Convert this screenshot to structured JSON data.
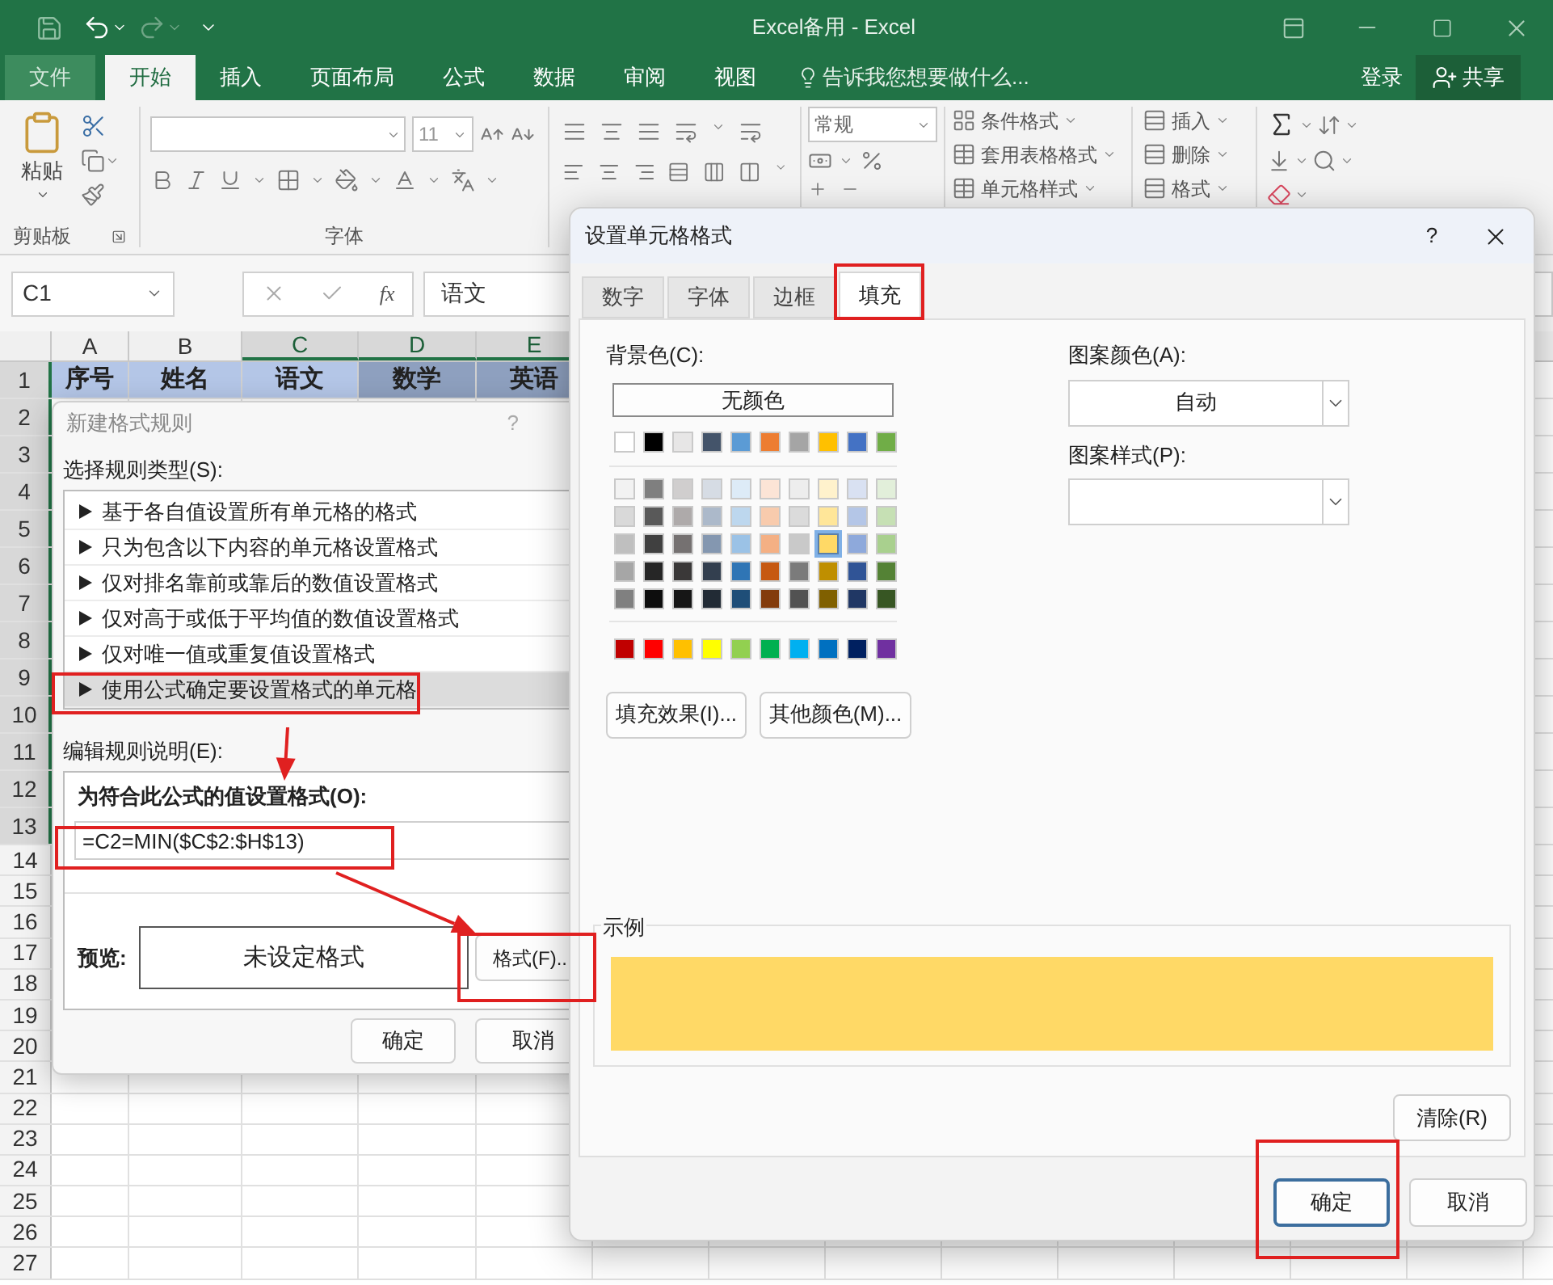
{
  "window": {
    "title": "Excel备用 - Excel"
  },
  "ribbon_tabs": [
    {
      "label": "文件",
      "kind": "file",
      "selected": false
    },
    {
      "label": "开始",
      "kind": "tab",
      "selected": true
    },
    {
      "label": "插入",
      "kind": "tab",
      "selected": false
    },
    {
      "label": "页面布局",
      "kind": "tab",
      "selected": false
    },
    {
      "label": "公式",
      "kind": "tab",
      "selected": false
    },
    {
      "label": "数据",
      "kind": "tab",
      "selected": false
    },
    {
      "label": "审阅",
      "kind": "tab",
      "selected": false
    },
    {
      "label": "视图",
      "kind": "tab",
      "selected": false
    }
  ],
  "tell_me": {
    "placeholder": "告诉我您想要做什么..."
  },
  "sign_in": "登录",
  "share": "共享",
  "ribbon": {
    "paste": "粘贴",
    "clipboard_label": "剪贴板",
    "font_size": "11",
    "font_label": "字体",
    "number_format": "常规",
    "styles": [
      "条件格式",
      "套用表格格式",
      "单元格样式"
    ],
    "cells": [
      "插入",
      "删除",
      "格式"
    ]
  },
  "formula_bar": {
    "name_box": "C1",
    "function_label": "fx",
    "value": "语文"
  },
  "sheet": {
    "columns": [
      {
        "label": "A",
        "selected": false
      },
      {
        "label": "B",
        "selected": false
      },
      {
        "label": "C",
        "selected": true
      },
      {
        "label": "D",
        "selected": true
      },
      {
        "label": "E",
        "selected": true
      }
    ],
    "header_cells": [
      {
        "text": "序号",
        "selected": false
      },
      {
        "text": "姓名",
        "selected": false
      },
      {
        "text": "语文",
        "selected": false
      },
      {
        "text": "数学",
        "selected": true
      },
      {
        "text": "英语",
        "selected": true
      }
    ],
    "rows": [
      {
        "label": "1",
        "selected": true
      },
      {
        "label": "2",
        "selected": true
      },
      {
        "label": "3",
        "selected": true
      },
      {
        "label": "4",
        "selected": true
      },
      {
        "label": "5",
        "selected": true
      },
      {
        "label": "6",
        "selected": true
      },
      {
        "label": "7",
        "selected": true
      },
      {
        "label": "8",
        "selected": true
      },
      {
        "label": "9",
        "selected": true
      },
      {
        "label": "10",
        "selected": true
      },
      {
        "label": "11",
        "selected": true
      },
      {
        "label": "12",
        "selected": true
      },
      {
        "label": "13",
        "selected": true
      },
      {
        "label": "14",
        "selected": false
      },
      {
        "label": "15",
        "selected": false
      },
      {
        "label": "16",
        "selected": false
      },
      {
        "label": "17",
        "selected": false
      },
      {
        "label": "18",
        "selected": false
      },
      {
        "label": "19",
        "selected": false
      },
      {
        "label": "20",
        "selected": false
      },
      {
        "label": "21",
        "selected": false
      },
      {
        "label": "22",
        "selected": false
      },
      {
        "label": "23",
        "selected": false
      },
      {
        "label": "24",
        "selected": false
      },
      {
        "label": "25",
        "selected": false
      },
      {
        "label": "26",
        "selected": false
      },
      {
        "label": "27",
        "selected": false
      }
    ]
  },
  "rule_dialog": {
    "title": "新建格式规则",
    "help": "?",
    "type_label": "选择规则类型(S):",
    "rule_types": [
      {
        "label": "基于各自值设置所有单元格的格式",
        "selected": false
      },
      {
        "label": "只为包含以下内容的单元格设置格式",
        "selected": false
      },
      {
        "label": "仅对排名靠前或靠后的数值设置格式",
        "selected": false
      },
      {
        "label": "仅对高于或低于平均值的数值设置格式",
        "selected": false
      },
      {
        "label": "仅对唯一值或重复值设置格式",
        "selected": false
      },
      {
        "label": "使用公式确定要设置格式的单元格",
        "selected": true
      }
    ],
    "edit_label": "编辑规则说明(E):",
    "formula_label": "为符合此公式的值设置格式(O):",
    "formula": "=C2=MIN($C$2:$H$13)",
    "preview_label": "预览:",
    "preview_text": "未设定格式",
    "format_button": "格式(F)..",
    "ok": "确定",
    "cancel": "取消"
  },
  "format_dialog": {
    "title": "设置单元格格式",
    "help": "?",
    "tabs": [
      {
        "label": "数字",
        "selected": false
      },
      {
        "label": "字体",
        "selected": false
      },
      {
        "label": "边框",
        "selected": false
      },
      {
        "label": "填充",
        "selected": true
      }
    ],
    "bg_label": "背景色(C):",
    "no_color": "无颜色",
    "theme_colors": [
      {
        "color": "#ffffff",
        "selected": false
      },
      {
        "color": "#000000",
        "selected": false
      },
      {
        "color": "#e7e6e6",
        "selected": false
      },
      {
        "color": "#44546a",
        "selected": false
      },
      {
        "color": "#5b9bd5",
        "selected": false
      },
      {
        "color": "#ed7d31",
        "selected": false
      },
      {
        "color": "#a5a5a5",
        "selected": false
      },
      {
        "color": "#ffc000",
        "selected": false
      },
      {
        "color": "#4472c4",
        "selected": false
      },
      {
        "color": "#70ad47",
        "selected": false
      }
    ],
    "tints": [
      [
        {
          "color": "#f2f2f2",
          "selected": false
        },
        {
          "color": "#7f7f7f",
          "selected": false
        },
        {
          "color": "#d0cece",
          "selected": false
        },
        {
          "color": "#d6dce4",
          "selected": false
        },
        {
          "color": "#ddebf7",
          "selected": false
        },
        {
          "color": "#fce4d6",
          "selected": false
        },
        {
          "color": "#ededed",
          "selected": false
        },
        {
          "color": "#fff2cc",
          "selected": false
        },
        {
          "color": "#d9e1f2",
          "selected": false
        },
        {
          "color": "#e2efda",
          "selected": false
        }
      ],
      [
        {
          "color": "#d9d9d9",
          "selected": false
        },
        {
          "color": "#595959",
          "selected": false
        },
        {
          "color": "#aeaaaa",
          "selected": false
        },
        {
          "color": "#acb9ca",
          "selected": false
        },
        {
          "color": "#bdd7ee",
          "selected": false
        },
        {
          "color": "#f8cbad",
          "selected": false
        },
        {
          "color": "#dbdbdb",
          "selected": false
        },
        {
          "color": "#ffe699",
          "selected": false
        },
        {
          "color": "#b4c6e7",
          "selected": false
        },
        {
          "color": "#c6e0b4",
          "selected": false
        }
      ],
      [
        {
          "color": "#bfbfbf",
          "selected": false
        },
        {
          "color": "#404040",
          "selected": false
        },
        {
          "color": "#757171",
          "selected": false
        },
        {
          "color": "#8497b0",
          "selected": false
        },
        {
          "color": "#9bc2e6",
          "selected": false
        },
        {
          "color": "#f4b084",
          "selected": false
        },
        {
          "color": "#c9c9c9",
          "selected": false
        },
        {
          "color": "#ffd966",
          "selected": true
        },
        {
          "color": "#8ea9db",
          "selected": false
        },
        {
          "color": "#a9d08e",
          "selected": false
        }
      ],
      [
        {
          "color": "#a6a6a6",
          "selected": false
        },
        {
          "color": "#262626",
          "selected": false
        },
        {
          "color": "#3a3838",
          "selected": false
        },
        {
          "color": "#333f4f",
          "selected": false
        },
        {
          "color": "#2f75b5",
          "selected": false
        },
        {
          "color": "#c65911",
          "selected": false
        },
        {
          "color": "#7b7b7b",
          "selected": false
        },
        {
          "color": "#bf8f00",
          "selected": false
        },
        {
          "color": "#305496",
          "selected": false
        },
        {
          "color": "#548235",
          "selected": false
        }
      ],
      [
        {
          "color": "#808080",
          "selected": false
        },
        {
          "color": "#0d0d0d",
          "selected": false
        },
        {
          "color": "#161616",
          "selected": false
        },
        {
          "color": "#222b35",
          "selected": false
        },
        {
          "color": "#1f4e78",
          "selected": false
        },
        {
          "color": "#833c0c",
          "selected": false
        },
        {
          "color": "#525252",
          "selected": false
        },
        {
          "color": "#806000",
          "selected": false
        },
        {
          "color": "#203764",
          "selected": false
        },
        {
          "color": "#375623",
          "selected": false
        }
      ]
    ],
    "standard_colors": [
      {
        "color": "#c00000",
        "selected": false
      },
      {
        "color": "#ff0000",
        "selected": false
      },
      {
        "color": "#ffc000",
        "selected": false
      },
      {
        "color": "#ffff00",
        "selected": false
      },
      {
        "color": "#92d050",
        "selected": false
      },
      {
        "color": "#00b050",
        "selected": false
      },
      {
        "color": "#00b0f0",
        "selected": false
      },
      {
        "color": "#0070c0",
        "selected": false
      },
      {
        "color": "#002060",
        "selected": false
      },
      {
        "color": "#7030a0",
        "selected": false
      }
    ],
    "fill_effects": "填充效果(I)...",
    "more_colors": "其他颜色(M)...",
    "pattern_color_label": "图案颜色(A):",
    "pattern_color": "自动",
    "pattern_style_label": "图案样式(P):",
    "sample_label": "示例",
    "sample": {
      "color": "#ffd966"
    },
    "clear": "清除(R)",
    "ok": "确定",
    "cancel": "取消"
  }
}
